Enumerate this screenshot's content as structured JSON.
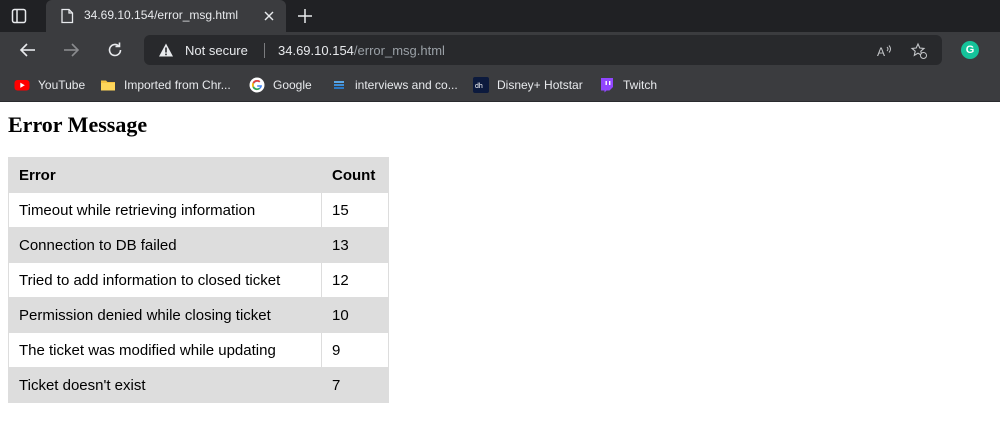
{
  "browser": {
    "tab": {
      "title": "34.69.10.154/error_msg.html"
    },
    "address_bar": {
      "security_label": "Not secure",
      "url_host": "34.69.10.154",
      "url_path": "/error_msg.html"
    },
    "extension": {
      "letter": "G"
    },
    "bookmarks": [
      {
        "label": "YouTube",
        "icon": "youtube-icon"
      },
      {
        "label": "Imported from Chr...",
        "icon": "folder-icon"
      },
      {
        "label": "Google",
        "icon": "google-icon"
      },
      {
        "label": "interviews and co...",
        "icon": "stack-icon"
      },
      {
        "label": "Disney+ Hotstar",
        "icon": "hotstar-icon"
      },
      {
        "label": "Twitch",
        "icon": "twitch-icon"
      }
    ],
    "colors": {
      "tabstrip": "#202124",
      "toolbar": "#3b3c3f",
      "omnibox": "#28292c",
      "grammarly": "#15c39a"
    }
  },
  "page": {
    "title": "Error Message",
    "table": {
      "headers": [
        "Error",
        "Count"
      ],
      "rows": [
        [
          "Timeout while retrieving information",
          "15"
        ],
        [
          "Connection to DB failed",
          "13"
        ],
        [
          "Tried to add information to closed ticket",
          "12"
        ],
        [
          "Permission denied while closing ticket",
          "10"
        ],
        [
          "The ticket was modified while updating",
          "9"
        ],
        [
          "Ticket doesn't exist",
          "7"
        ]
      ]
    },
    "colors": {
      "row_shade": "#dddddd"
    }
  }
}
